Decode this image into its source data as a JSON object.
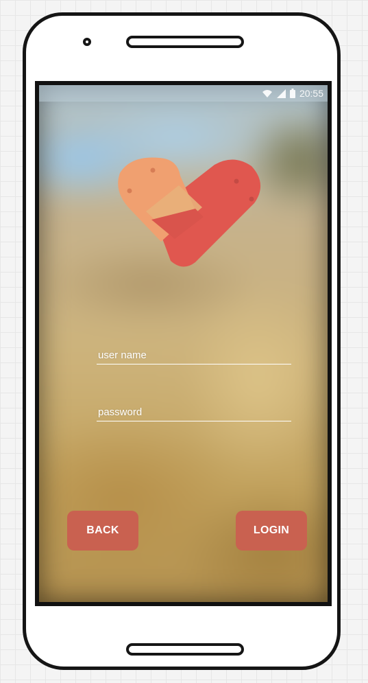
{
  "status_bar": {
    "time": "20:55",
    "icons": [
      "wifi-icon",
      "signal-icon",
      "battery-icon"
    ]
  },
  "logo": {
    "icon": "bandaged-heart-icon",
    "colors": {
      "left_lobe": "#f0a070",
      "right_lobe": "#e0574f",
      "bandage": "#e8b07a"
    }
  },
  "form": {
    "username_placeholder": "user name",
    "password_placeholder": "password"
  },
  "buttons": {
    "back_label": "BACK",
    "login_label": "LOGIN"
  },
  "colors": {
    "button_bg": "#c96150",
    "text": "#ffffff"
  }
}
